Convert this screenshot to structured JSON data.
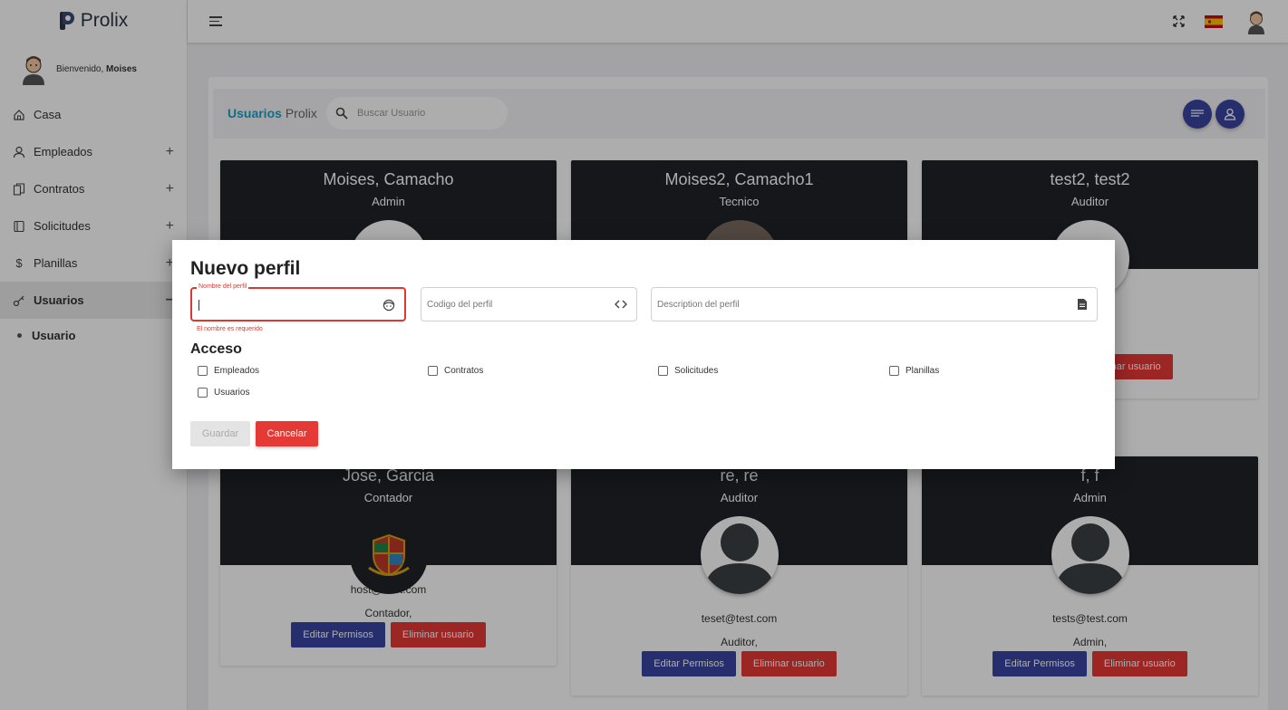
{
  "app": {
    "name": "Prolix"
  },
  "sidebar": {
    "welcome_prefix": "Bienvenido,",
    "user_name": "Moises",
    "items": [
      {
        "label": "Casa",
        "icon": "home-icon",
        "expandable": false
      },
      {
        "label": "Empleados",
        "icon": "user-icon",
        "expandable": true,
        "toggle": "+"
      },
      {
        "label": "Contratos",
        "icon": "documents-icon",
        "expandable": true,
        "toggle": "+"
      },
      {
        "label": "Solicitudes",
        "icon": "book-icon",
        "expandable": true,
        "toggle": "+"
      },
      {
        "label": "Planillas",
        "icon": "dollar-icon",
        "expandable": true,
        "toggle": "+"
      },
      {
        "label": "Usuarios",
        "icon": "key-icon",
        "expandable": true,
        "toggle": "−",
        "active": true
      }
    ],
    "sub_items": [
      {
        "label": "Usuario"
      }
    ]
  },
  "topbar": {
    "icons": [
      "menu-icon",
      "fullscreen-icon",
      "spain-flag-icon",
      "avatar"
    ]
  },
  "header": {
    "title_highlight": "Usuarios",
    "title_rest": "Prolix",
    "search_placeholder": "Buscar Usuario"
  },
  "users": [
    {
      "name": "Moises, Camacho",
      "role": "Admin"
    },
    {
      "name": "Moises2, Camacho1",
      "role": "Tecnico"
    },
    {
      "name": "test2, test2",
      "role": "Auditor"
    },
    {
      "name": "Jose, Garcia",
      "role": "Contador",
      "email": "host@host.com",
      "role_line": "Contador,"
    },
    {
      "name": "re, re",
      "role": "Auditor",
      "email": "teset@test.com",
      "role_line": "Auditor,"
    },
    {
      "name": "f, f",
      "role": "Admin",
      "email": "tests@test.com",
      "role_line": "Admin,"
    }
  ],
  "card_buttons": {
    "edit": "Editar Permisos",
    "delete": "Eliminar usuario",
    "delete_partial": "minar usuario"
  },
  "modal": {
    "title": "Nuevo perfil",
    "name_label": "Nombre del perfil",
    "name_value": "",
    "name_error": "El nombre es requerido",
    "code_placeholder": "Codigo del perfil",
    "desc_placeholder": "Description del perfil",
    "access_title": "Acceso",
    "access_options": [
      "Empleados",
      "Contratos",
      "Solicitudes",
      "Planillas",
      "Usuarios"
    ],
    "save_label": "Guardar",
    "cancel_label": "Cancelar"
  },
  "colors": {
    "primary": "#3a45a1",
    "danger": "#e53935",
    "accent": "#16a3c8",
    "card_dark": "#1f2329"
  }
}
